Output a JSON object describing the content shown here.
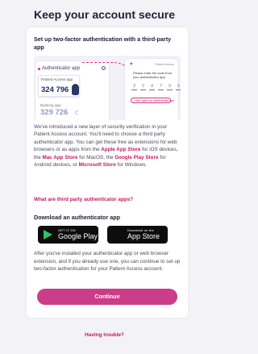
{
  "page": {
    "title": "Keep your account secure",
    "setup_heading": "Set up two-factor authentication with a third-party app",
    "illustration": {
      "left_phone": {
        "title": "Authenticator app",
        "entries": [
          {
            "name": "Patient Access app",
            "code": "324 796"
          },
          {
            "name": "Banking app",
            "code": "329 726"
          }
        ]
      },
      "right_phone": {
        "brand": "Patient Access",
        "prompt": "Please enter the code from your authenticator app",
        "digits": [
          "3",
          "2",
          "4",
          "7",
          "9",
          "6"
        ],
        "link": "I can't open my authenticator app"
      }
    },
    "intro": {
      "p1": "We've introduced a new layer of security verification in your Patient Access account. You'll need to choose a third party authenticator app. You can get these free as extensions for web browsers or as apps from the ",
      "apple_store": "Apple App Store",
      "p2": " for iOS devices, the ",
      "mac_store": "Mac App Store",
      "p3": " for MacOS, the ",
      "google_store": "Google Play Store",
      "p4": " for Android devices, or ",
      "ms_store": "Microsoft Store",
      "p5": " for Windows."
    },
    "what_apps_link": "What are third party authenticator apps?",
    "download_heading": "Download an authenticator app",
    "google_play": {
      "small": "GET IT ON",
      "big": "Google Play"
    },
    "app_store": {
      "small": "Download on the",
      "big": "App Store"
    },
    "after_text": "After you've installed your authenticator app or web browser extension, and if you already use one, you can continue to set up two-factor authentication for your Patient Access account.",
    "continue_label": "Continue",
    "trouble_link": "Having trouble?"
  },
  "colors": {
    "accent": "#cc3d89",
    "link": "#c2185b",
    "background": "#f3f2f7"
  }
}
